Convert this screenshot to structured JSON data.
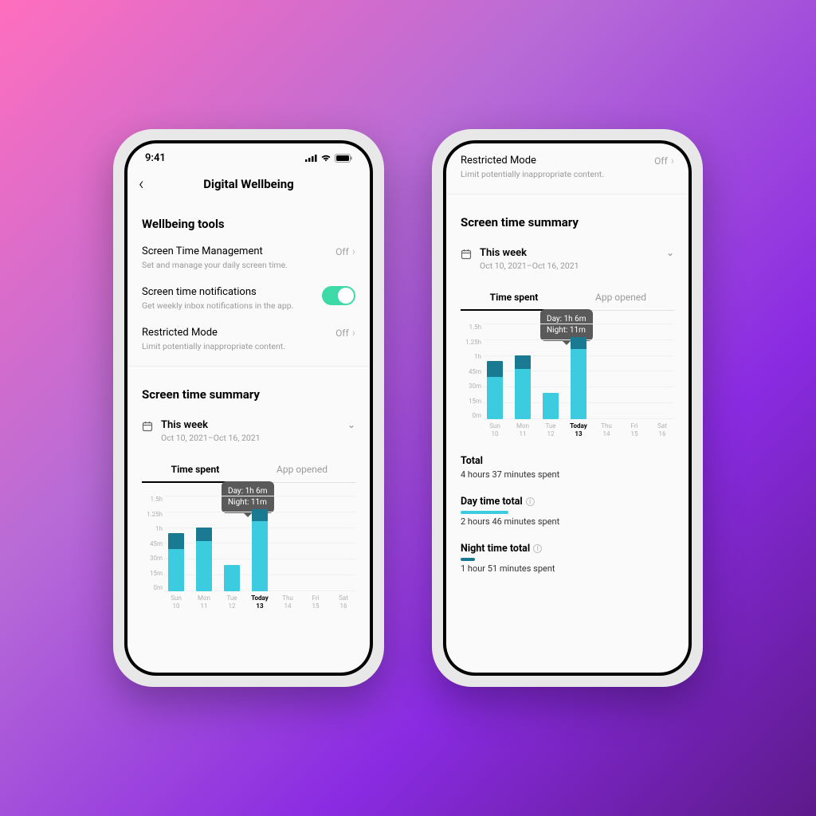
{
  "status": {
    "time": "9:41"
  },
  "header": {
    "title": "Digital Wellbeing"
  },
  "tools": {
    "section_title": "Wellbeing tools",
    "screen_time": {
      "label": "Screen Time Management",
      "desc": "Set and manage your daily screen time.",
      "value": "Off"
    },
    "notifications": {
      "label": "Screen time notifications",
      "desc": "Get weekly inbox notifications in the app."
    },
    "restricted": {
      "label": "Restricted Mode",
      "desc": "Limit potentially inappropriate content.",
      "value": "Off"
    }
  },
  "summary": {
    "section_title": "Screen time summary",
    "period_label": "This week",
    "period_range": "Oct 10, 2021–Oct 16, 2021",
    "tabs": {
      "time_spent": "Time spent",
      "app_opened": "App opened"
    }
  },
  "tooltip": {
    "day": "Day: 1h  6m",
    "night": "Night: 11m"
  },
  "totals": {
    "total_label": "Total",
    "total_val": "4 hours 37 minutes spent",
    "day_label": "Day time total",
    "day_val": "2 hours 46 minutes spent",
    "night_label": "Night time total",
    "night_val": "1 hour 51 minutes spent"
  },
  "chart_data": {
    "type": "bar",
    "title": "Screen time summary — Time spent",
    "xlabel": "",
    "ylabel": "",
    "ylim": [
      0,
      90
    ],
    "y_ticks": [
      "1.5h",
      "1.25h",
      "1h",
      "45m",
      "30m",
      "15m",
      "0m"
    ],
    "categories": [
      {
        "dow": "Sun",
        "day": "10"
      },
      {
        "dow": "Mon",
        "day": "11"
      },
      {
        "dow": "Tue",
        "day": "12"
      },
      {
        "dow": "Today",
        "day": "13",
        "bold": true
      },
      {
        "dow": "Thu",
        "day": "14"
      },
      {
        "dow": "Fri",
        "day": "15"
      },
      {
        "dow": "Sat",
        "day": "16"
      }
    ],
    "series": [
      {
        "name": "Day",
        "color": "#3dcbe0",
        "values": [
          40,
          47,
          25,
          66,
          null,
          null,
          null
        ]
      },
      {
        "name": "Night",
        "color": "#1a7a92",
        "values": [
          15,
          13,
          0,
          11,
          null,
          null,
          null
        ]
      }
    ],
    "tooltip_index": 3
  },
  "colors": {
    "day_bar": "#3dcbe0",
    "night_bar": "#1a7a92",
    "toggle_on": "#3dd9a7"
  }
}
